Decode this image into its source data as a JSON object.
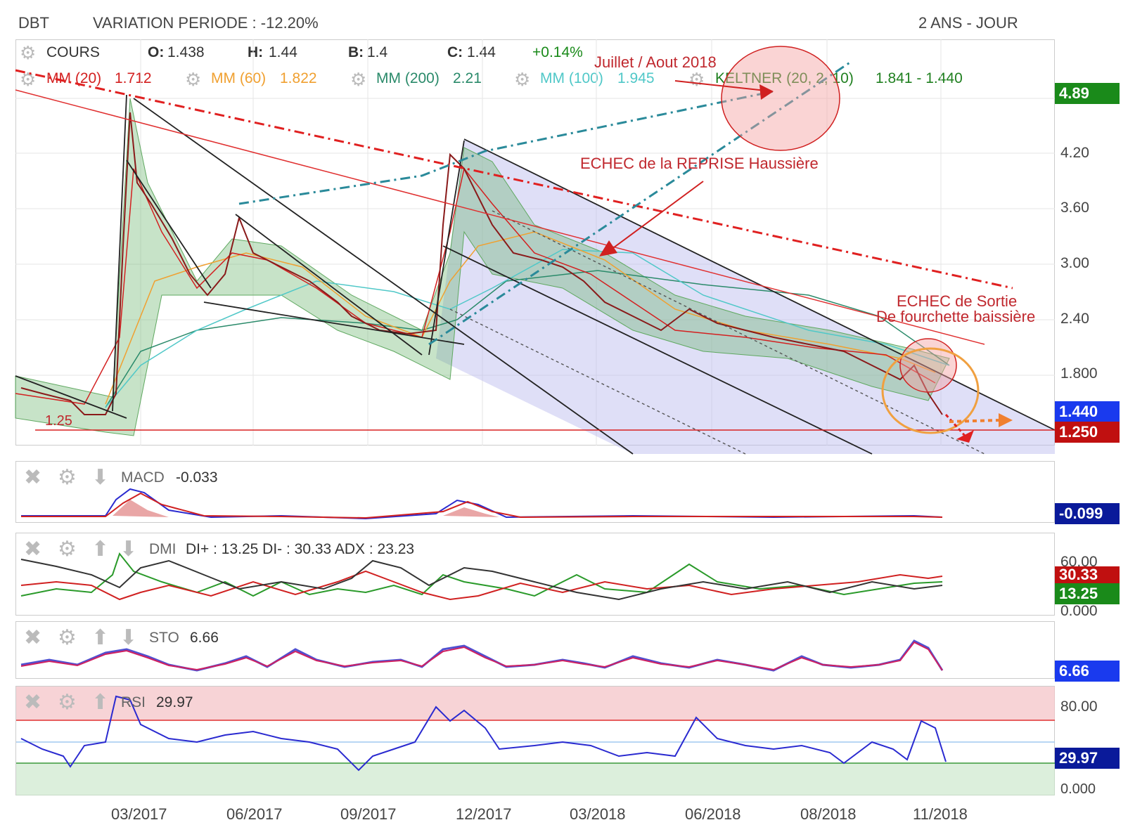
{
  "header": {
    "ticker": "DBT",
    "variation": "VARIATION PERIODE : -12.20%",
    "period": "2 ANS - JOUR"
  },
  "quote": {
    "cours": "COURS",
    "o_label": "O:",
    "o": "1.438",
    "h_label": "H:",
    "h": "1.44",
    "b_label": "B:",
    "b": "1.4",
    "c_label": "C:",
    "c": "1.44",
    "change": "+0.14%"
  },
  "indicators": {
    "mm20": "MM (20)",
    "mm20_val": "1.712",
    "mm60": "MM (60)",
    "mm60_val": "1.822",
    "mm200": "MM (200)",
    "mm200_val": "2.21",
    "mm100": "MM (100)",
    "mm100_val": "1.945",
    "keltner": "KELTNER (20, 2, 10)",
    "keltner_val": "1.841 - 1.440"
  },
  "annotations": {
    "juillet": "Juillet / Aout 2018",
    "echec_reprise": "ECHEC de la REPRISE Haussière",
    "echec_sortie_1": "ECHEC de Sortie",
    "echec_sortie_2": "De fourchette baissière",
    "support": "1.25"
  },
  "price_axis": {
    "ticks": [
      "4.20",
      "3.60",
      "3.00",
      "2.40",
      "1.800"
    ],
    "badge_top": "4.89",
    "badge_last": "1.440",
    "badge_support": "1.250"
  },
  "macd": {
    "label": "MACD",
    "value": "-0.033",
    "badge": "-0.099"
  },
  "dmi": {
    "label": "DMI",
    "value": "DI+ : 13.25 DI- : 30.33 ADX : 23.23",
    "tick_top": "60.00",
    "tick_bottom": "0.000",
    "badge_di_minus": "30.33",
    "badge_di_plus": "13.25"
  },
  "sto": {
    "label": "STO",
    "value": "6.66",
    "badge": "6.66"
  },
  "rsi": {
    "label": "RSI",
    "value": "29.97",
    "tick_top": "80.00",
    "tick_bottom": "0.000",
    "badge": "29.97"
  },
  "x_axis": [
    "03/2017",
    "06/2017",
    "09/2017",
    "12/2017",
    "03/2018",
    "06/2018",
    "08/2018",
    "11/2018"
  ],
  "colors": {
    "mm20": "#d32020",
    "mm60": "#f0a030",
    "mm200": "#2a8a6a",
    "mm100": "#50c8c8",
    "keltner": "#208020",
    "green_badge": "#1a8a1a",
    "blue_badge": "#1a3aee",
    "red_badge": "#c01010",
    "navy_badge": "#0a1a9a"
  },
  "chart_data": {
    "type": "line",
    "title": "",
    "x_range": [
      "12/2016",
      "12/2018"
    ],
    "ylim": [
      1.25,
      4.89
    ],
    "series": [
      {
        "name": "COURS",
        "x": [
          "12/2016",
          "01/2017",
          "02/2017",
          "02/2017",
          "03/2017",
          "04/2017",
          "05/2017",
          "05/2017",
          "06/2017",
          "07/2017",
          "08/2017",
          "09/2017",
          "10/2017",
          "11/2017",
          "11/2017",
          "12/2017",
          "01/2018",
          "02/2018",
          "03/2018",
          "04/2018",
          "05/2018",
          "06/2018",
          "07/2018",
          "08/2018",
          "09/2018",
          "10/2018",
          "11/2018"
        ],
        "values": [
          1.55,
          1.45,
          1.32,
          4.7,
          3.8,
          3.0,
          2.75,
          3.5,
          3.1,
          2.8,
          2.3,
          2.2,
          1.95,
          3.0,
          4.25,
          3.6,
          3.05,
          3.0,
          2.7,
          2.35,
          2.65,
          2.35,
          2.15,
          2.05,
          1.8,
          1.95,
          1.44
        ]
      },
      {
        "name": "MM (20)",
        "values": []
      },
      {
        "name": "MM (60)",
        "values": []
      },
      {
        "name": "MM (200)",
        "values": []
      },
      {
        "name": "MM (100)",
        "values": []
      },
      {
        "name": "KELTNER (20, 2, 10)",
        "values": []
      }
    ]
  }
}
